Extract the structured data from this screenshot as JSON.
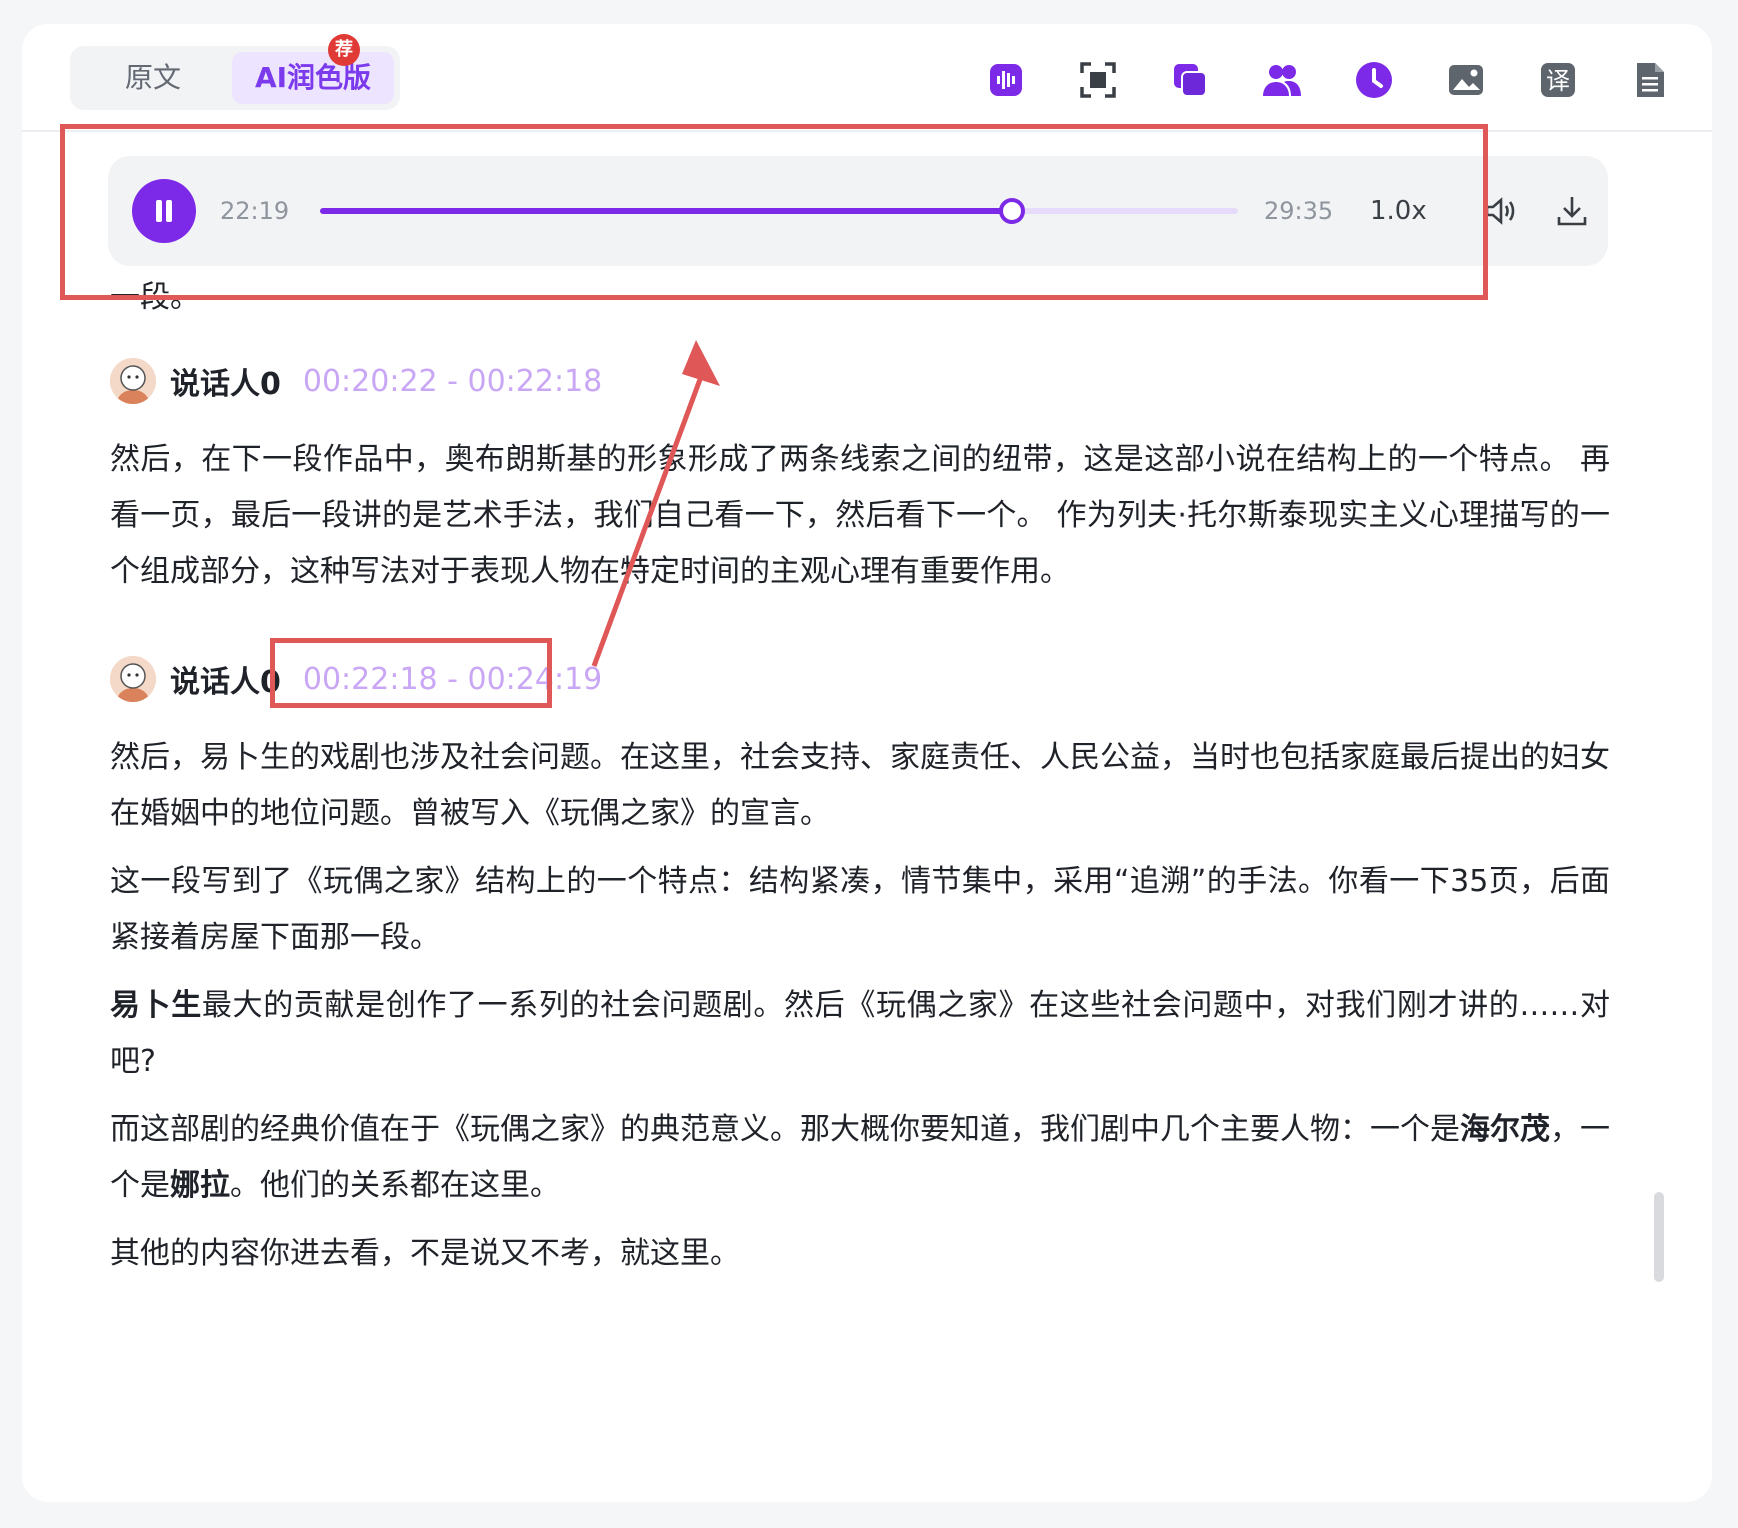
{
  "tabs": {
    "original": "原文",
    "ai": "AI润色版",
    "badge": "荐"
  },
  "toolbar": {
    "icons": [
      "audio-wave-icon",
      "scan-icon",
      "copy-icon",
      "users-icon",
      "clock-icon",
      "image-icon",
      "translate-icon",
      "document-icon"
    ],
    "translate_glyph": "译"
  },
  "player": {
    "current": "22:19",
    "total": "29:35",
    "progress": 0.754,
    "speed": "1.0x"
  },
  "tail_text": "一段。",
  "segments": [
    {
      "speaker": "说话人0",
      "time": "00:20:22 - 00:22:18",
      "paragraphs": [
        "然后，在下一段作品中，奥布朗斯基的形象形成了两条线索之间的纽带，这是这部小说在结构上的一个特点。 再看一页，最后一段讲的是艺术手法，我们自己看一下，然后看下一个。 作为列夫·托尔斯泰现实主义心理描写的一个组成部分，这种写法对于表现人物在特定时间的主观心理有重要作用。"
      ]
    },
    {
      "speaker": "说话人0",
      "time": "00:22:18 - 00:24:19",
      "paragraphs": [
        "然后，易卜生的戏剧也涉及社会问题。在这里，社会支持、家庭责任、人民公益，当时也包括家庭最后提出的妇女在婚姻中的地位问题。曾被写入《玩偶之家》的宣言。",
        "这一段写到了《玩偶之家》结构上的一个特点：结构紧凑，情节集中，采用“追溯”的手法。你看一下35页，后面紧接着房屋下面那一段。"
      ],
      "p3_bold": "易卜生",
      "p3_rest": "最大的贡献是创作了一系列的社会问题剧。然后《玩偶之家》在这些社会问题中，对我们刚才讲的……对吧?",
      "p4_a": "而这部剧的经典价值在于《玩偶之家》的典范意义。那大概你要知道，我们剧中几个主要人物：一个是",
      "p4_b1": "海尔茂",
      "p4_c": "，一个是",
      "p4_b2": "娜拉",
      "p4_d": "。他们的关系都在这里。",
      "p5": "其他的内容你进去看，不是说又不考，就这里。"
    }
  ],
  "colors": {
    "accent": "#7c2ae8",
    "highlight": "#e05757",
    "time": "#c9a7f5"
  }
}
